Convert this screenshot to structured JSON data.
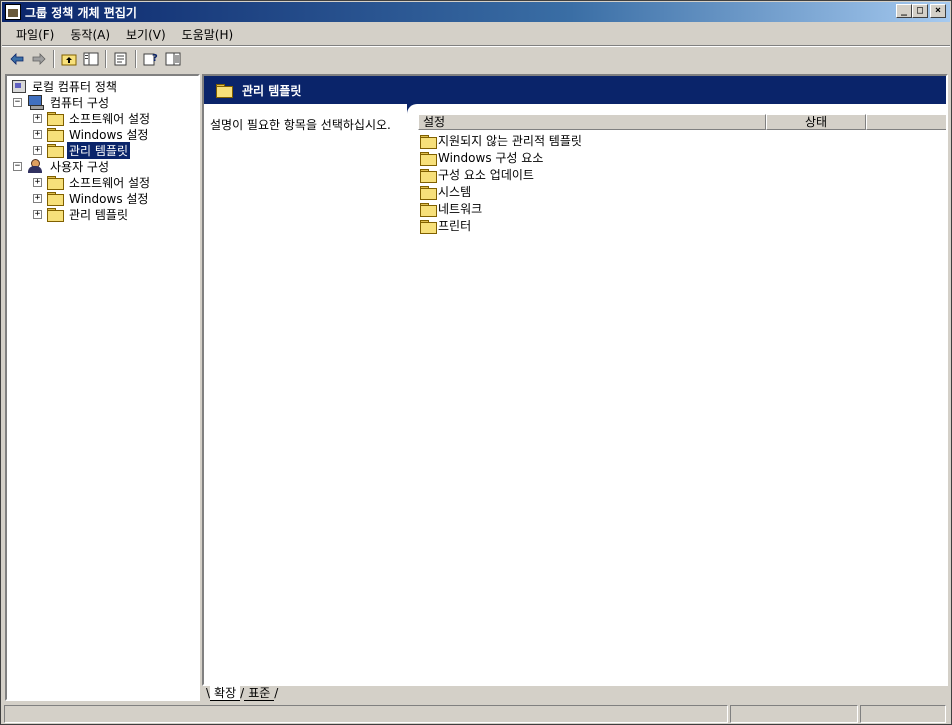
{
  "window": {
    "title": "그룹 정책 개체 편집기",
    "buttons": {
      "minimize": "_",
      "maximize": "□",
      "close": "×"
    }
  },
  "menu": {
    "items": [
      "파일(F)",
      "동작(A)",
      "보기(V)",
      "도움말(H)"
    ]
  },
  "toolbar": {
    "buttons": [
      "back-arrow-icon",
      "forward-arrow-icon",
      "up-folder-icon",
      "show-hide-tree-icon",
      "export-list-icon",
      "help-icon",
      "properties-icon"
    ]
  },
  "tree": {
    "root": "로컬 컴퓨터 정책",
    "items": [
      {
        "label": "컴퓨터 구성",
        "level": 1,
        "expander": "−",
        "icon": "computer-icon"
      },
      {
        "label": "소프트웨어 설정",
        "level": 2,
        "expander": "+",
        "icon": "folder-icon"
      },
      {
        "label": "Windows 설정",
        "level": 2,
        "expander": "+",
        "icon": "folder-icon"
      },
      {
        "label": "관리 템플릿",
        "level": 2,
        "expander": "+",
        "icon": "folder-icon",
        "selected": true
      },
      {
        "label": "사용자 구성",
        "level": 1,
        "expander": "−",
        "icon": "user-icon"
      },
      {
        "label": "소프트웨어 설정",
        "level": 2,
        "expander": "+",
        "icon": "folder-icon"
      },
      {
        "label": "Windows 설정",
        "level": 2,
        "expander": "+",
        "icon": "folder-icon"
      },
      {
        "label": "관리 템플릿",
        "level": 2,
        "expander": "+",
        "icon": "folder-icon"
      }
    ]
  },
  "content": {
    "banner_title": "관리 템플릿",
    "description": "설명이 필요한 항목을 선택하십시오.",
    "columns": [
      "설정",
      "상태"
    ],
    "rows": [
      "지원되지 않는 관리적 템플릿",
      "Windows 구성 요소",
      "구성 요소 업데이트",
      "시스템",
      "네트워크",
      "프린터"
    ]
  },
  "tabs": {
    "active": "확장",
    "inactive": "표준"
  }
}
